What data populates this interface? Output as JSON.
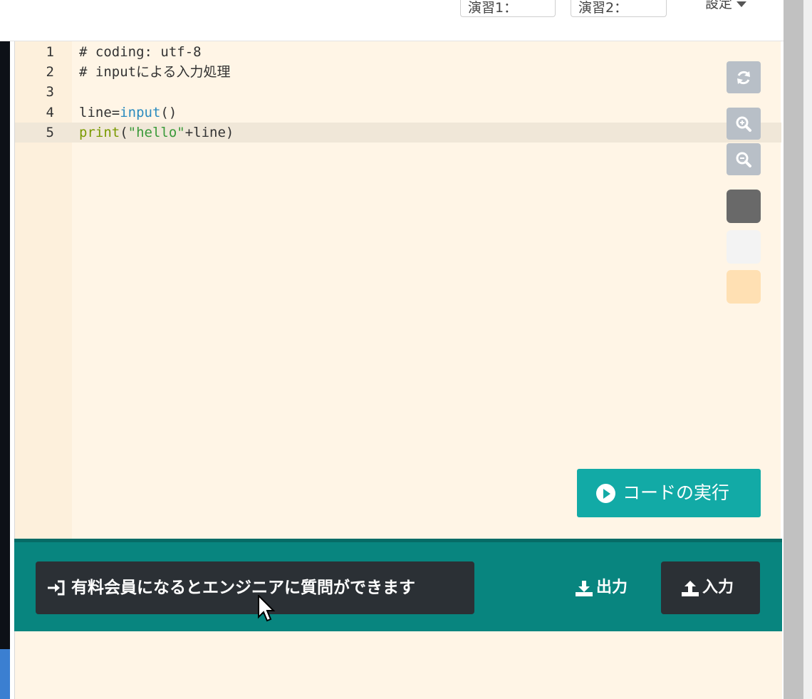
{
  "header": {
    "select1_label": "演習1：",
    "select2_label": "演習2：",
    "settings_label": "設定"
  },
  "editor": {
    "lines": [
      {
        "number": "1",
        "text": "# coding: utf-8"
      },
      {
        "number": "2",
        "text": "# inputによる入力処理"
      },
      {
        "number": "3",
        "text": ""
      },
      {
        "number": "4",
        "text": "line=input()"
      },
      {
        "number": "5",
        "text": "print(\"hello\"+line)"
      }
    ],
    "active_line": 5
  },
  "tools": {
    "refresh_icon": "refresh-icon",
    "zoom_in_icon": "zoom-in-icon",
    "zoom_out_icon": "zoom-out-icon",
    "themes": [
      {
        "name": "dark-theme",
        "color": "#696969"
      },
      {
        "name": "light-theme",
        "color": "#f3f3f3"
      },
      {
        "name": "cream-theme",
        "color": "#ffe0b3"
      }
    ]
  },
  "run": {
    "label": "コードの実行",
    "icon": "play-circle-icon",
    "color": "#12aaa6"
  },
  "bottom": {
    "member_label": "有料会員になるとエンジニアに質問ができます",
    "member_icon": "sign-in-icon",
    "output_label": "出力",
    "output_icon": "download-icon",
    "input_label": "入力",
    "input_icon": "upload-icon",
    "bar_color": "#08857f"
  }
}
